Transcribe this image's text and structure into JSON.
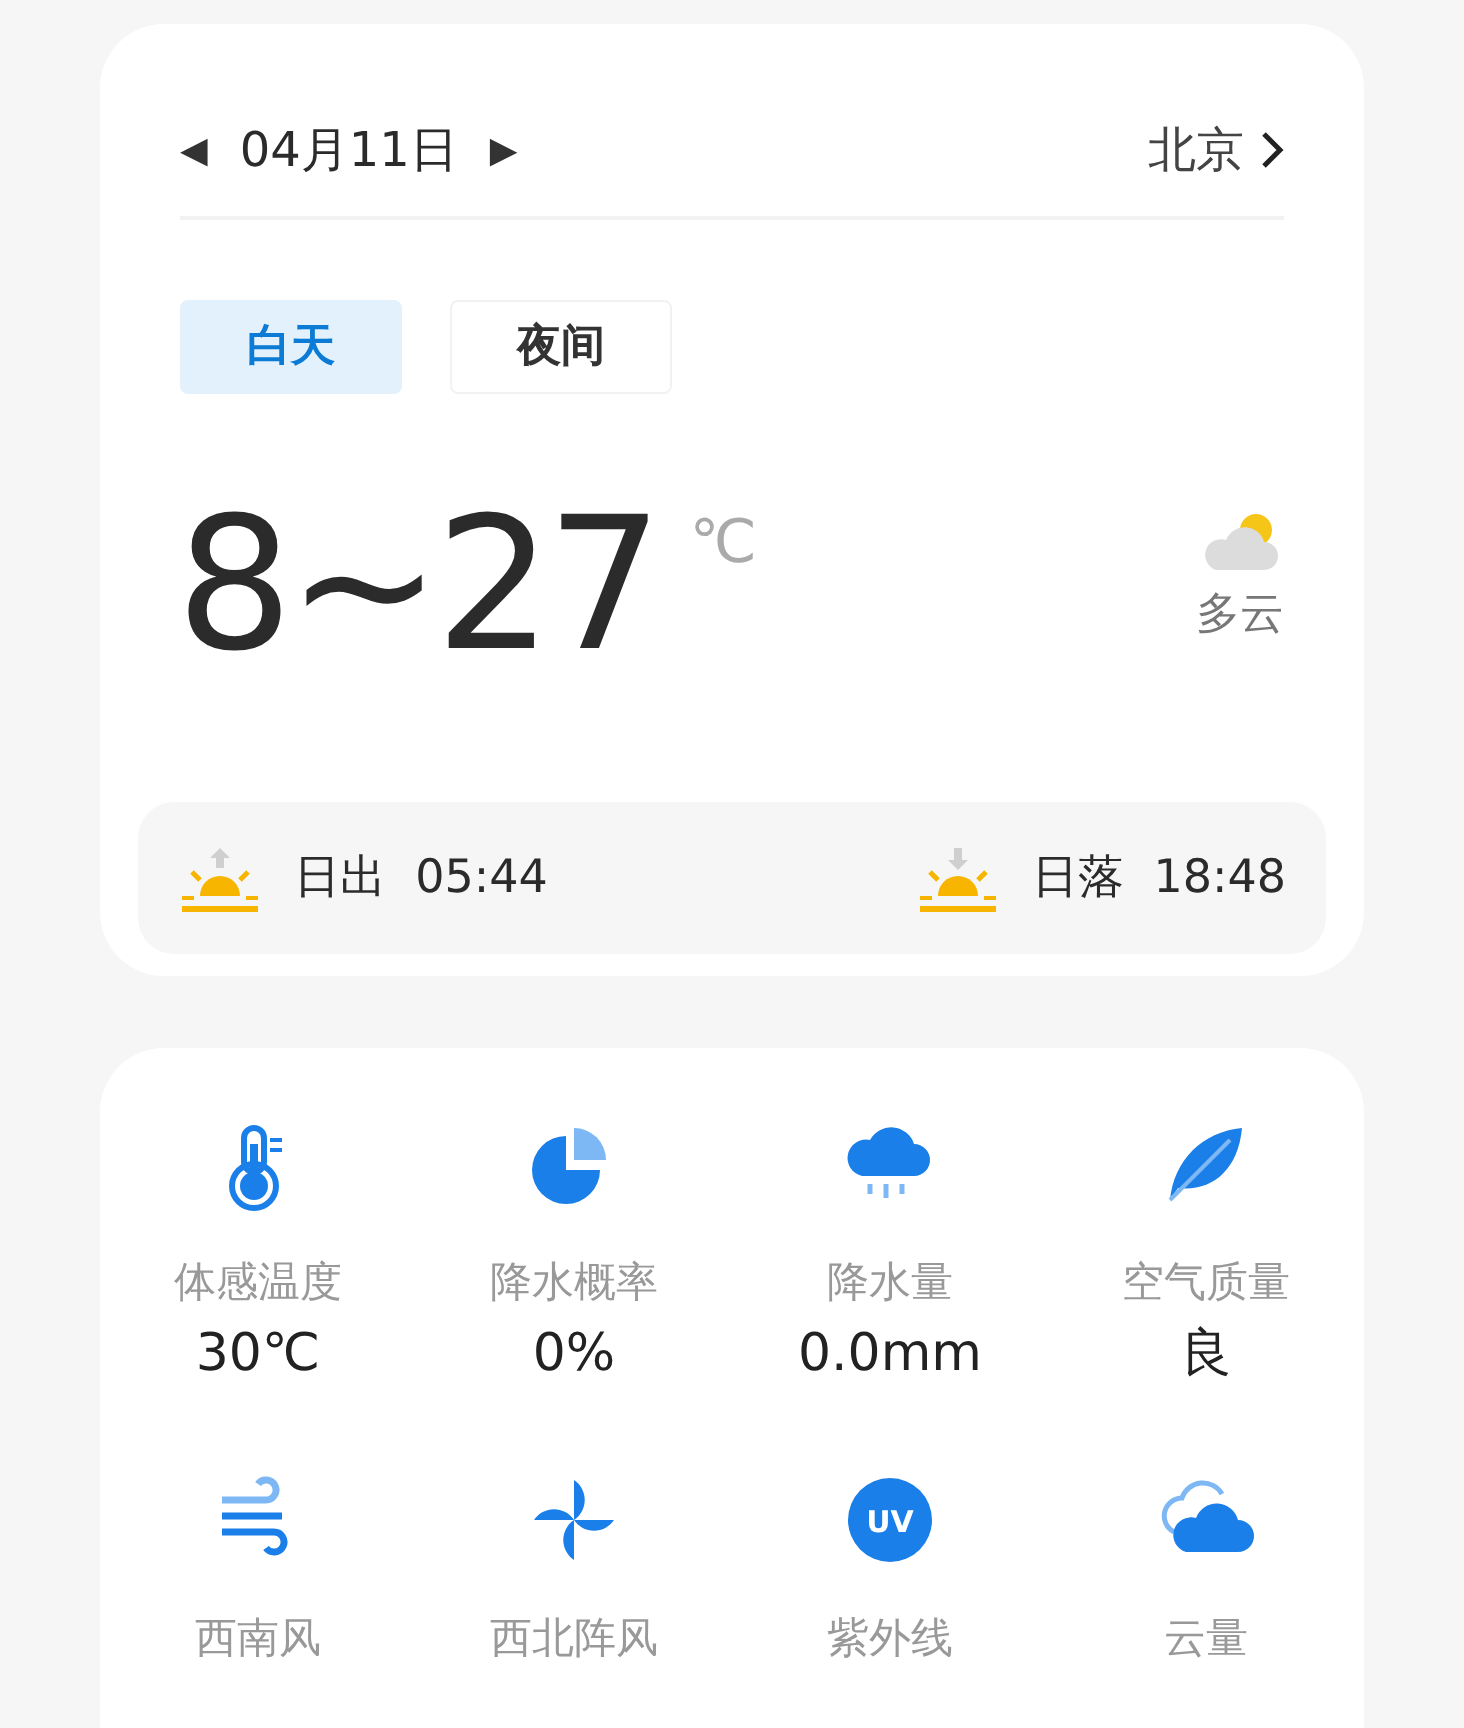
{
  "header": {
    "prev": "◀",
    "date": "04月11日",
    "next": "▶",
    "city": "北京"
  },
  "tabs": [
    {
      "label": "白天",
      "selected": true
    },
    {
      "label": "夜间",
      "selected": false
    }
  ],
  "temperature": {
    "range": "8~27",
    "unit": "℃",
    "condition": "多云"
  },
  "sun": [
    {
      "kind": "rise",
      "label": "日出",
      "time": "05:44"
    },
    {
      "kind": "set",
      "label": "日落",
      "time": "18:48"
    }
  ],
  "details": [
    {
      "kind": "thermometer",
      "label": "体感温度",
      "value": "30℃"
    },
    {
      "kind": "pie",
      "label": "降水概率",
      "value": "0%"
    },
    {
      "kind": "rain",
      "label": "降水量",
      "value": "0.0mm"
    },
    {
      "kind": "leaf",
      "label": "空气质量",
      "value": "良"
    },
    {
      "kind": "wind",
      "label": "西南风"
    },
    {
      "kind": "fan",
      "label": "西北阵风"
    },
    {
      "kind": "uv",
      "icon_text": "UV",
      "label": "紫外线"
    },
    {
      "kind": "cloud",
      "label": "云量"
    }
  ]
}
